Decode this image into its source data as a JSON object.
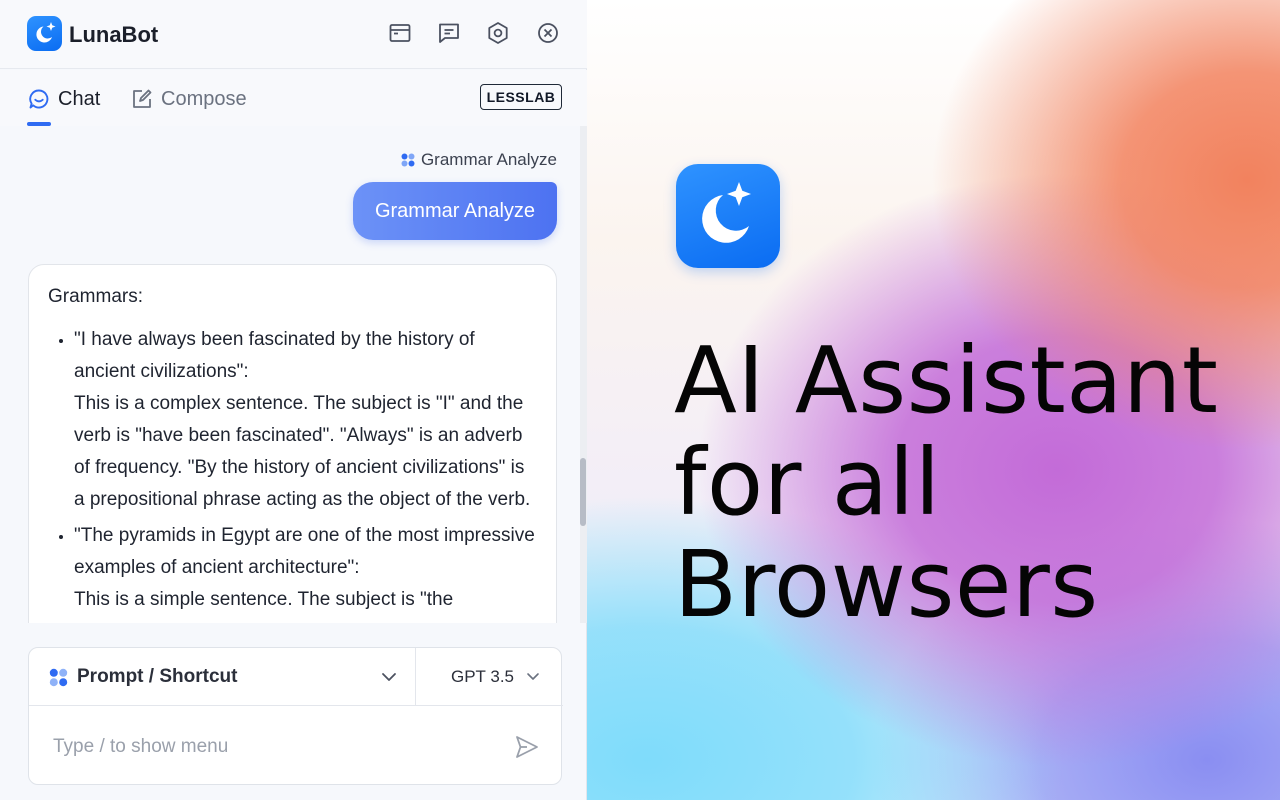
{
  "app": {
    "name": "LunaBot",
    "accent": "#2f6bf2",
    "logo_icon": "moon-sparkle-icon"
  },
  "toolbar": {
    "icons": [
      "window-icon",
      "feedback-icon",
      "gear-icon",
      "close-icon"
    ]
  },
  "tabs": [
    {
      "label": "Chat",
      "icon": "chat-bubble-icon",
      "active": true
    },
    {
      "label": "Compose",
      "icon": "edit-icon",
      "active": false
    }
  ],
  "badge": "LESSLAB",
  "conversation": {
    "shortcut_tag": "Grammar Analyze",
    "user_message": "Grammar Analyze",
    "bot_reply": {
      "heading": "Grammars:",
      "items": [
        {
          "quote": "\"I have always been fascinated by the history of ancient civilizations\":",
          "explanation": "This is a complex sentence. The subject is \"I\" and the verb is \"have been fascinated\". \"Always\" is an adverb of frequency. \"By the history of ancient civilizations\" is a prepositional phrase acting as the object of the verb."
        },
        {
          "quote": "\"The pyramids in Egypt are one of the most impressive examples of ancient architecture\":",
          "explanation": "This is a simple sentence. The subject is \"the pyramids\""
        }
      ]
    }
  },
  "composer": {
    "prompt_select_label": "Prompt / Shortcut",
    "model": "GPT 3.5",
    "placeholder": "Type / to show menu",
    "send_icon": "send-icon"
  },
  "hero": {
    "title_lines": [
      "AI Assistant",
      "for all",
      "Browsers"
    ],
    "gradient_colors": [
      "#f2825e",
      "#c36bd8",
      "#7fdcfb",
      "#8a8ef2"
    ]
  }
}
